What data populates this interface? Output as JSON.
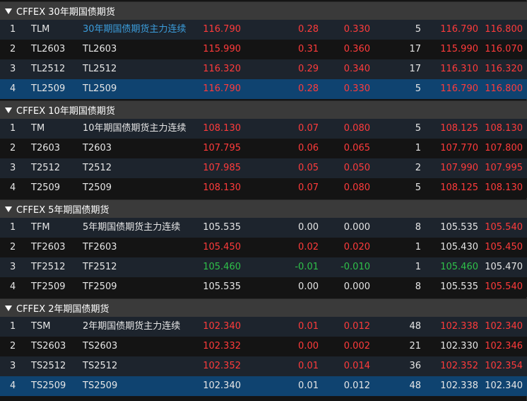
{
  "colors": {
    "up": "#ff3b3b",
    "down": "#2fc14a",
    "flat": "#e6e6e6",
    "link": "#3b9ddc",
    "selected_row": "#0f4370"
  },
  "groups": [
    {
      "title": "CFFEX 30年期国债期货",
      "rows": [
        {
          "idx": "1",
          "code": "TLM",
          "name": "30年期国债期货主力连续",
          "name_link": true,
          "price": "116.790",
          "chg": "0.28",
          "pct": "0.330",
          "vol": "5",
          "bid": "116.790",
          "ask": "116.800",
          "price_c": "up",
          "chg_c": "up",
          "pct_c": "up",
          "bid_c": "up",
          "ask_c": "up",
          "selected": false
        },
        {
          "idx": "2",
          "code": "TL2603",
          "name": "TL2603",
          "name_link": false,
          "price": "115.990",
          "chg": "0.31",
          "pct": "0.360",
          "vol": "17",
          "bid": "115.990",
          "ask": "116.070",
          "price_c": "up",
          "chg_c": "up",
          "pct_c": "up",
          "bid_c": "up",
          "ask_c": "up",
          "selected": false
        },
        {
          "idx": "3",
          "code": "TL2512",
          "name": "TL2512",
          "name_link": false,
          "price": "116.320",
          "chg": "0.29",
          "pct": "0.340",
          "vol": "17",
          "bid": "116.310",
          "ask": "116.320",
          "price_c": "up",
          "chg_c": "up",
          "pct_c": "up",
          "bid_c": "up",
          "ask_c": "up",
          "selected": false
        },
        {
          "idx": "4",
          "code": "TL2509",
          "name": "TL2509",
          "name_link": false,
          "price": "116.790",
          "chg": "0.28",
          "pct": "0.330",
          "vol": "5",
          "bid": "116.790",
          "ask": "116.800",
          "price_c": "up",
          "chg_c": "up",
          "pct_c": "up",
          "bid_c": "up",
          "ask_c": "up",
          "selected": true
        }
      ]
    },
    {
      "title": "CFFEX 10年期国债期货",
      "rows": [
        {
          "idx": "1",
          "code": "TM",
          "name": "10年期国债期货主力连续",
          "name_link": false,
          "price": "108.130",
          "chg": "0.07",
          "pct": "0.080",
          "vol": "5",
          "bid": "108.125",
          "ask": "108.130",
          "price_c": "up",
          "chg_c": "up",
          "pct_c": "up",
          "bid_c": "up",
          "ask_c": "up",
          "selected": false
        },
        {
          "idx": "2",
          "code": "T2603",
          "name": "T2603",
          "name_link": false,
          "price": "107.795",
          "chg": "0.06",
          "pct": "0.065",
          "vol": "1",
          "bid": "107.770",
          "ask": "107.800",
          "price_c": "up",
          "chg_c": "up",
          "pct_c": "up",
          "bid_c": "up",
          "ask_c": "up",
          "selected": false
        },
        {
          "idx": "3",
          "code": "T2512",
          "name": "T2512",
          "name_link": false,
          "price": "107.985",
          "chg": "0.05",
          "pct": "0.050",
          "vol": "2",
          "bid": "107.990",
          "ask": "107.995",
          "price_c": "up",
          "chg_c": "up",
          "pct_c": "up",
          "bid_c": "up",
          "ask_c": "up",
          "selected": false
        },
        {
          "idx": "4",
          "code": "T2509",
          "name": "T2509",
          "name_link": false,
          "price": "108.130",
          "chg": "0.07",
          "pct": "0.080",
          "vol": "5",
          "bid": "108.125",
          "ask": "108.130",
          "price_c": "up",
          "chg_c": "up",
          "pct_c": "up",
          "bid_c": "up",
          "ask_c": "up",
          "selected": false
        }
      ]
    },
    {
      "title": "CFFEX 5年期国债期货",
      "rows": [
        {
          "idx": "1",
          "code": "TFM",
          "name": "5年期国债期货主力连续",
          "name_link": false,
          "price": "105.535",
          "chg": "0.00",
          "pct": "0.000",
          "vol": "8",
          "bid": "105.535",
          "ask": "105.540",
          "price_c": "flat",
          "chg_c": "flat",
          "pct_c": "flat",
          "bid_c": "flat",
          "ask_c": "up",
          "selected": false
        },
        {
          "idx": "2",
          "code": "TF2603",
          "name": "TF2603",
          "name_link": false,
          "price": "105.450",
          "chg": "0.02",
          "pct": "0.020",
          "vol": "1",
          "bid": "105.430",
          "ask": "105.450",
          "price_c": "up",
          "chg_c": "up",
          "pct_c": "up",
          "bid_c": "flat",
          "ask_c": "up",
          "selected": false
        },
        {
          "idx": "3",
          "code": "TF2512",
          "name": "TF2512",
          "name_link": false,
          "price": "105.460",
          "chg": "-0.01",
          "pct": "-0.010",
          "vol": "1",
          "bid": "105.460",
          "ask": "105.470",
          "price_c": "down",
          "chg_c": "down",
          "pct_c": "down",
          "bid_c": "down",
          "ask_c": "flat",
          "selected": false
        },
        {
          "idx": "4",
          "code": "TF2509",
          "name": "TF2509",
          "name_link": false,
          "price": "105.535",
          "chg": "0.00",
          "pct": "0.000",
          "vol": "8",
          "bid": "105.535",
          "ask": "105.540",
          "price_c": "flat",
          "chg_c": "flat",
          "pct_c": "flat",
          "bid_c": "flat",
          "ask_c": "up",
          "selected": false
        }
      ]
    },
    {
      "title": "CFFEX 2年期国债期货",
      "rows": [
        {
          "idx": "1",
          "code": "TSM",
          "name": "2年期国债期货主力连续",
          "name_link": false,
          "price": "102.340",
          "chg": "0.01",
          "pct": "0.012",
          "vol": "48",
          "bid": "102.338",
          "ask": "102.340",
          "price_c": "up",
          "chg_c": "up",
          "pct_c": "up",
          "bid_c": "up",
          "ask_c": "up",
          "selected": false
        },
        {
          "idx": "2",
          "code": "TS2603",
          "name": "TS2603",
          "name_link": false,
          "price": "102.332",
          "chg": "0.00",
          "pct": "0.002",
          "vol": "21",
          "bid": "102.330",
          "ask": "102.346",
          "price_c": "up",
          "chg_c": "up",
          "pct_c": "up",
          "bid_c": "flat",
          "ask_c": "up",
          "selected": false
        },
        {
          "idx": "3",
          "code": "TS2512",
          "name": "TS2512",
          "name_link": false,
          "price": "102.352",
          "chg": "0.01",
          "pct": "0.014",
          "vol": "36",
          "bid": "102.352",
          "ask": "102.354",
          "price_c": "up",
          "chg_c": "up",
          "pct_c": "up",
          "bid_c": "up",
          "ask_c": "up",
          "selected": false
        },
        {
          "idx": "4",
          "code": "TS2509",
          "name": "TS2509",
          "name_link": false,
          "price": "102.340",
          "chg": "0.01",
          "pct": "0.012",
          "vol": "48",
          "bid": "102.338",
          "ask": "102.340",
          "price_c": "flat",
          "chg_c": "flat",
          "pct_c": "flat",
          "bid_c": "flat",
          "ask_c": "flat",
          "selected": true
        }
      ]
    }
  ]
}
